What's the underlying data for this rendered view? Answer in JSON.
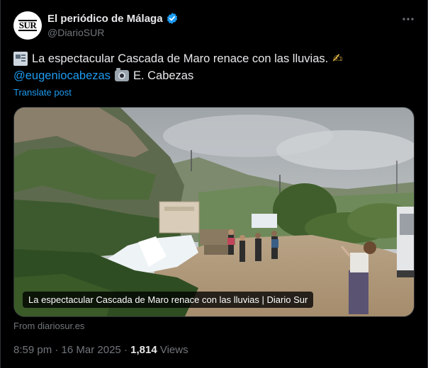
{
  "account": {
    "display_name": "El periódico de Málaga",
    "handle": "@DiarioSUR",
    "avatar_text": "SUR",
    "verified": true
  },
  "post": {
    "line1_text": "La espectacular Cascada de Maro renace con las lluvias.",
    "line2_mention": "@eugeniocabezas",
    "line2_credit": "E. Cabezas",
    "emojis": [
      "newspaper-icon",
      "writing-hand-icon",
      "camera-icon"
    ],
    "translate_label": "Translate post"
  },
  "link_card": {
    "caption": "La espectacular Cascada de Maro renace con las lluvias | Diario Sur",
    "source": "From diariosur.es"
  },
  "meta": {
    "time": "8:59 pm",
    "date": "16 Mar 2025",
    "views_count": "1,814",
    "views_label": "Views",
    "separator": "·"
  },
  "colors": {
    "background": "#000000",
    "text": "#e7e9ea",
    "muted": "#71767b",
    "accent": "#1d9bf0"
  }
}
